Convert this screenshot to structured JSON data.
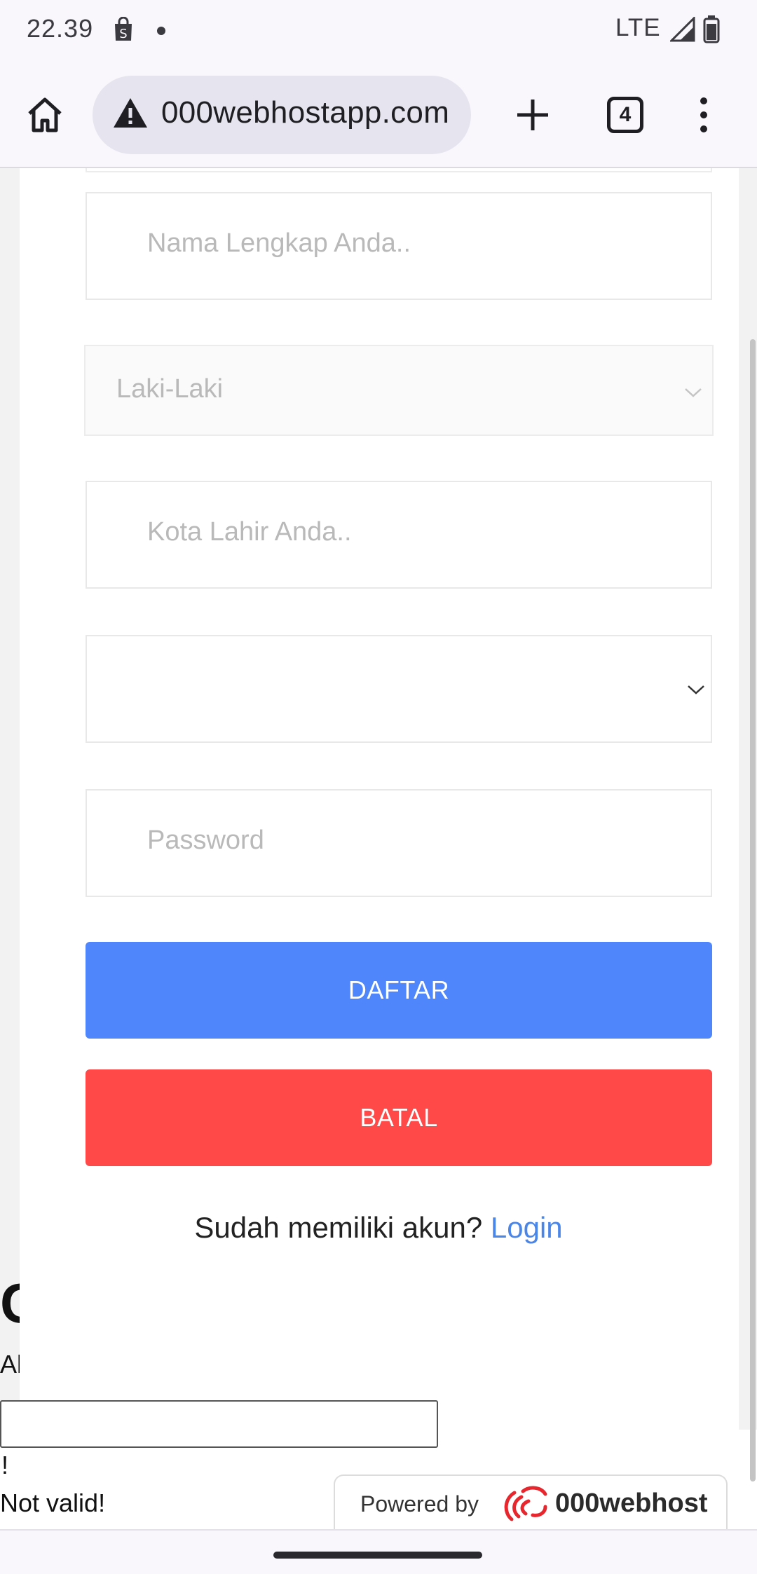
{
  "status_bar": {
    "time": "22.39",
    "network": "LTE",
    "shop_icon_letter": "S"
  },
  "browser": {
    "url": "000webhostapp.com",
    "tab_count": "4",
    "icons": [
      "home-icon",
      "warning-icon",
      "plus-icon",
      "tabs-icon",
      "more-vert-icon"
    ]
  },
  "form": {
    "fullname_placeholder": "Nama Lengkap Anda..",
    "gender_selected": "Laki-Laki",
    "birthcity_placeholder": "Kota Lahir Anda..",
    "date_selected": "",
    "password_placeholder": "Password",
    "submit_label": "DAFTAR",
    "cancel_label": "BATAL",
    "login_prompt": "Sudah memiliki akun?",
    "login_link": "Login"
  },
  "underlying_page": {
    "heading_fragment": "C",
    "text_fragment": "Al",
    "exclamation": "!",
    "validation_message": "Not valid!"
  },
  "footer_badge": {
    "powered_by": "Powered by",
    "brand": "000webhost"
  },
  "colors": {
    "primary_button": "#4f86fc",
    "danger_button": "#ff4848",
    "link": "#4a86e8",
    "badge_logo": "#e8262d"
  }
}
